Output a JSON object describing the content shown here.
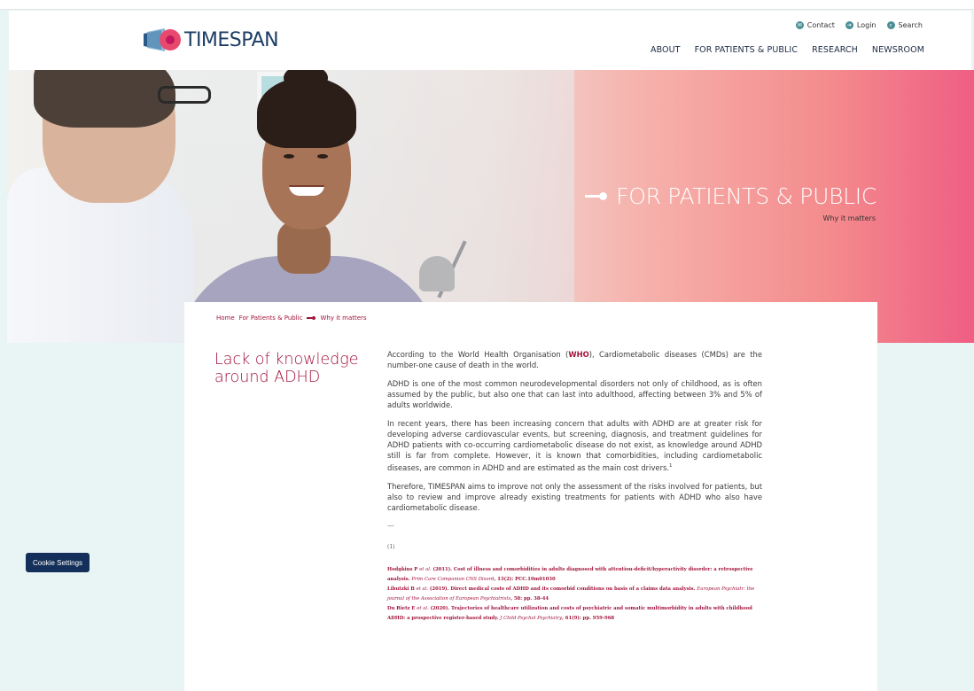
{
  "brand": {
    "name": "TIMESPAN",
    "accent": "#a2133c",
    "navy": "#1d3d63",
    "hero_pink": "#ef5e84"
  },
  "utility_nav": [
    {
      "icon": "contact-icon",
      "label": "Contact"
    },
    {
      "icon": "login-icon",
      "label": "Login"
    },
    {
      "icon": "search-icon",
      "label": "Search"
    }
  ],
  "main_nav": [
    "ABOUT",
    "FOR PATIENTS & PUBLIC",
    "RESEARCH",
    "NEWSROOM"
  ],
  "hero": {
    "title": "FOR PATIENTS & PUBLIC",
    "subtitle": "Why it matters"
  },
  "breadcrumb": [
    "Home",
    "For Patients & Public",
    "Why it matters"
  ],
  "page_title": "Lack of knowledge around ADHD",
  "article": {
    "p1_before": "According to the World Health Organisation (",
    "p1_link": "WHO",
    "p1_after": "), Cardiometabolic diseases (CMDs) are the number-one cause of death in the world.",
    "p2": "ADHD is one of the most common neurodevelopmental disorders not only of childhood, as is often assumed by the public, but also one that can last into adulthood, affecting between 3% and 5% of adults worldwide.",
    "p3": "In recent years, there has been increasing concern that adults with ADHD are at greater risk for developing adverse cardiovascular events, but screening, diagnosis, and treatment guidelines for ADHD patients with co-occurring cardiometabolic disease do not exist, as knowledge around ADHD still is far from complete. However, it is known that comorbidities, including cardiometabolic diseases, are common in ADHD and are estimated as the main cost drivers.",
    "p3_sup": "1",
    "p4": "Therefore, TIMESPAN aims to improve not only the assessment of the risks involved for patients, but also to review and improve already existing treatments for patients with ADHD who also have cardiometabolic disease.",
    "divider": "—",
    "footnote_marker": "(1)"
  },
  "references": [
    {
      "authors": "Hodgkins P ",
      "etal": "et al.",
      "rest": " (2011). Cost of illness and comorbidities in adults diagnosed with attention-deficit/hyperactivity disorder: a retrospective analysis. ",
      "journal": "Prim Care Companion CNS Disord",
      "tail": ", 13(2): PCC.10m01030"
    },
    {
      "authors": "Libutzki B ",
      "etal": "et al.",
      "rest": " (2019). Direct medical costs of ADHD and its comorbid conditions on basis of a claims data analysis. ",
      "journal": "European Psychiatr: the journal of the Association of European Psychiatrists",
      "tail": ", 58: pp. 38-44"
    },
    {
      "authors": "Du Rietz E ",
      "etal": "et al.",
      "rest": " (2020). Trajectories of healthcare utilization and costs of psychiatric and somatic multimorbidity in adults with childhood ADHD: a prospective register-based study. ",
      "journal": "J Child Psychol Psychiatry",
      "tail": ", 61(9): pp. 959-968"
    }
  ],
  "cookie_button": "Cookie Settings"
}
